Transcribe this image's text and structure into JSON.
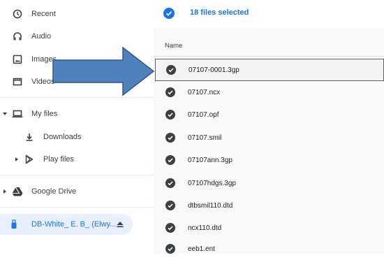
{
  "sidebar": {
    "items": [
      {
        "label": "Recent",
        "icon": "clock-icon"
      },
      {
        "label": "Audio",
        "icon": "headphones-icon"
      },
      {
        "label": "Images",
        "icon": "image-icon"
      },
      {
        "label": "Videos",
        "icon": "film-icon"
      },
      {
        "label": "My files",
        "icon": "laptop-icon"
      },
      {
        "label": "Downloads",
        "icon": "download-icon"
      },
      {
        "label": "Play files",
        "icon": "play-store-icon"
      },
      {
        "label": "Google Drive",
        "icon": "google-drive-icon"
      },
      {
        "label": "DB-White_ E. B_ (Elwy...",
        "icon": "usb-icon"
      }
    ]
  },
  "selection": {
    "text": "18 files selected"
  },
  "table": {
    "header_name": "Name",
    "files": [
      "07107-0001.3gp",
      "07107.ncx",
      "07107.opf",
      "07107.smil",
      "07107ann.3gp",
      "07107hdgs.3gp",
      "dtbsmil110.dtd",
      "ncx110.dtd",
      "eeb1.ent"
    ]
  },
  "colors": {
    "accent": "#1a73e8",
    "annotation_arrow": "#4f81bd",
    "selected_row_bg": "#e8f0fe"
  }
}
